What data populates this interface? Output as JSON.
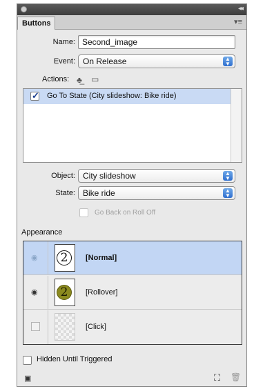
{
  "panel": {
    "tab_label": "Buttons"
  },
  "name_row": {
    "label": "Name:",
    "value": "Second_image"
  },
  "event_row": {
    "label": "Event:",
    "value": "On Release"
  },
  "actions": {
    "label": "Actions:",
    "items": [
      {
        "checked": true,
        "text": "Go To State (City slideshow: Bike ride)"
      }
    ]
  },
  "object_row": {
    "label": "Object:",
    "value": "City slideshow"
  },
  "state_row": {
    "label": "State:",
    "value": "Bike ride"
  },
  "go_back": {
    "label": "Go Back on Roll Off",
    "checked": false,
    "enabled": false
  },
  "appearance": {
    "label": "Appearance",
    "states": [
      {
        "name": "[Normal]",
        "number": "2",
        "selected": true,
        "visible": true,
        "style": "outline"
      },
      {
        "name": "[Rollover]",
        "number": "2",
        "selected": false,
        "visible": true,
        "style": "filled"
      },
      {
        "name": "[Click]",
        "number": "",
        "selected": false,
        "visible": false,
        "style": "empty"
      }
    ]
  },
  "hidden_until_triggered": {
    "label": "Hidden Until Triggered",
    "checked": false
  },
  "colors": {
    "selection": "#c2d6f4",
    "select_arrow": "#2f6fcf",
    "rollover_fill": "#8b8a1f"
  }
}
